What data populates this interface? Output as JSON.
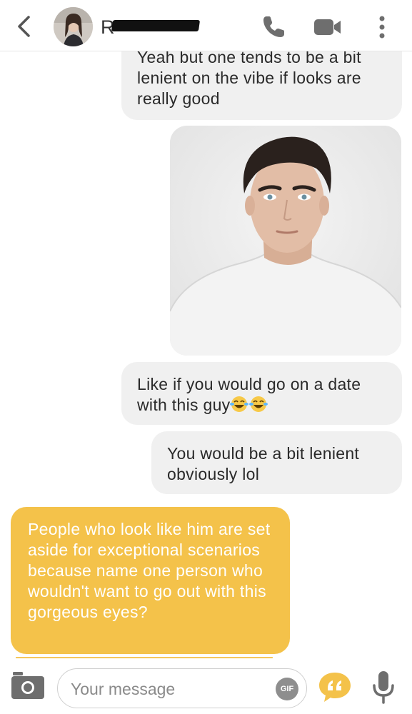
{
  "header": {
    "contact_name": "R",
    "icons": [
      "back-chevron-icon",
      "phone-icon",
      "video-camera-icon",
      "more-vertical-icon"
    ]
  },
  "messages": [
    {
      "sender": "me",
      "type": "text",
      "text": "Yeah but one tends to be a bit lenient on the vibe if looks are really good"
    },
    {
      "sender": "me",
      "type": "image",
      "alt": ""
    },
    {
      "sender": "me",
      "type": "text",
      "text": "Like if you would go on a date with this guy",
      "emoji": "face-with-tears-of-joy x2"
    },
    {
      "sender": "me",
      "type": "text",
      "text": "You would be a bit lenient obviously lol"
    },
    {
      "sender": "them",
      "type": "text",
      "text": "People who look like him are set aside for exceptional scenarios because name one person who wouldn't want to go out with this gorgeous eyes?"
    }
  ],
  "composer": {
    "placeholder": "Your message",
    "gif_label": "GIF"
  },
  "colors": {
    "incoming_bubble": "#f4c24a",
    "outgoing_bubble": "#f0f0f0",
    "icon_gray": "#6e6e6e"
  }
}
